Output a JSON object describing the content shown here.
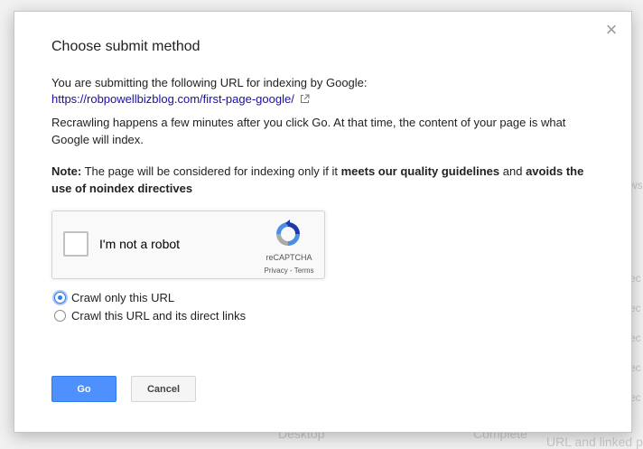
{
  "background": {
    "bottom_left_text": "Desktop",
    "bottom_status_text": "Complete",
    "bottom_right_text": "URL and linked pa",
    "side_fragments": [
      "ws",
      "ec",
      "ec",
      "ec",
      "ec",
      "ec",
      "ec",
      "ec"
    ]
  },
  "dialog": {
    "title": "Choose submit method",
    "close_glyph": "×",
    "intro": "You are submitting the following URL for indexing by Google:",
    "url": "https://robpowellbizblog.com/first-page-google/",
    "recrawl_text": "Recrawling happens a few minutes after you click Go. At that time, the content of your page is what Google will index.",
    "note_label": "Note:",
    "note_text_1": " The page will be considered for indexing only if it ",
    "note_bold_1": "meets our quality guidelines",
    "note_text_2": " and ",
    "note_bold_2": "avoids the use of noindex directives",
    "recaptcha": {
      "label": "I'm not a robot",
      "brand": "reCAPTCHA",
      "privacy": "Privacy",
      "separator": " - ",
      "terms": "Terms",
      "checked": false
    },
    "options": [
      {
        "label": "Crawl only this URL",
        "selected": true
      },
      {
        "label": "Crawl this URL and its direct links",
        "selected": false
      }
    ],
    "go_label": "Go",
    "cancel_label": "Cancel"
  },
  "colors": {
    "link": "#1a0dab",
    "go_button": "#4d90fe",
    "radio_selected": "#2e7de8"
  }
}
